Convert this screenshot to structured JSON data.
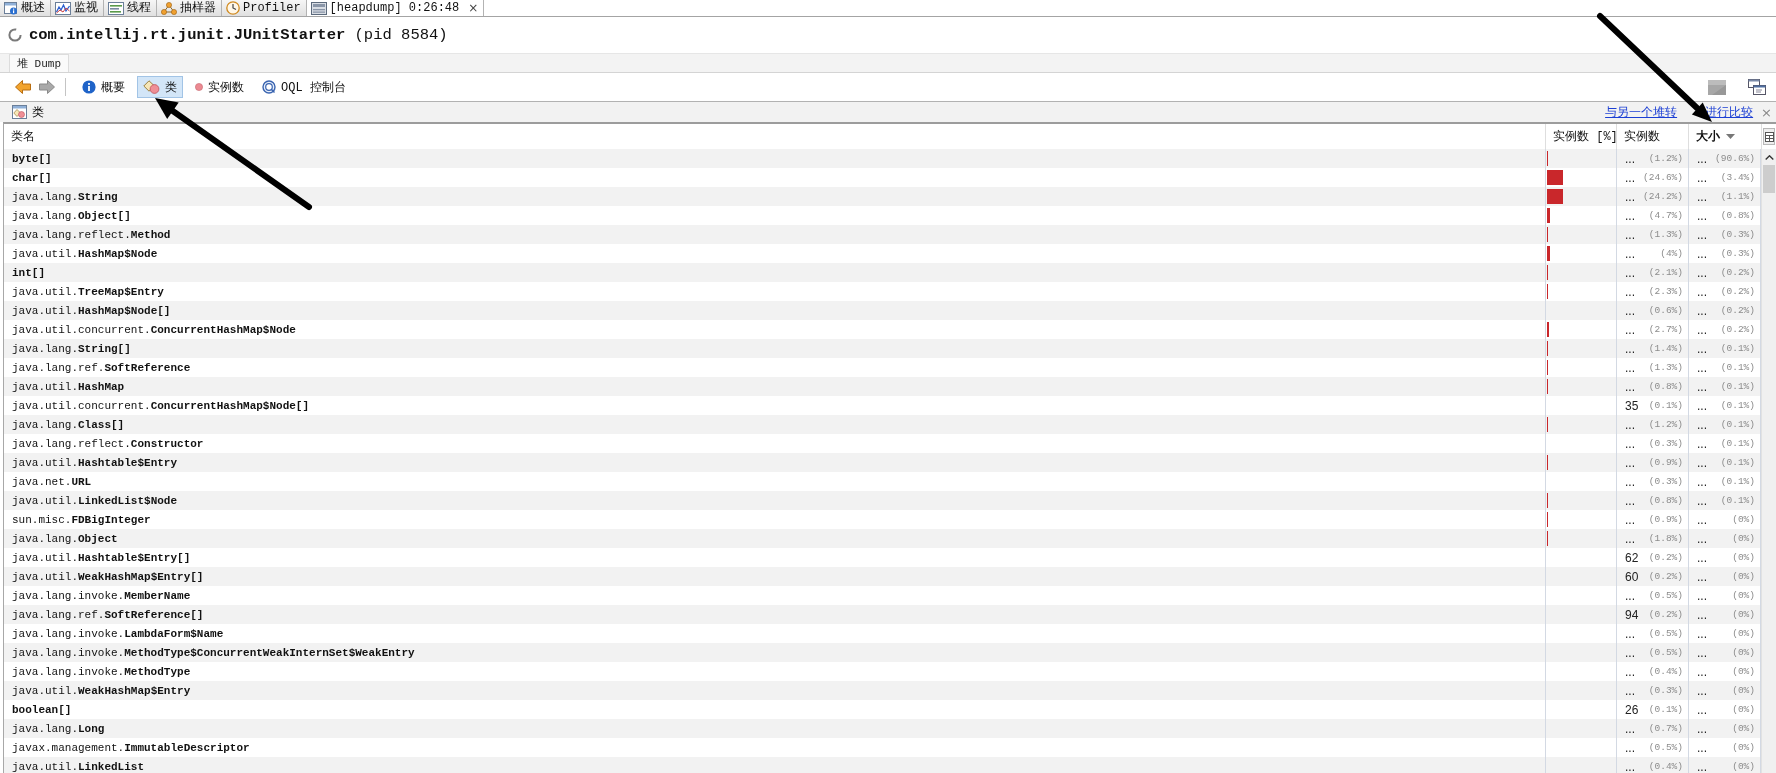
{
  "tabs": [
    {
      "kind": "overview",
      "label": "概述",
      "selected": false
    },
    {
      "kind": "monitor",
      "label": "监视",
      "selected": false
    },
    {
      "kind": "threads",
      "label": "线程",
      "selected": false
    },
    {
      "kind": "sampler",
      "label": "抽样器",
      "selected": false
    },
    {
      "kind": "profiler",
      "label": "Profiler",
      "selected": false
    },
    {
      "kind": "heapdump",
      "label": "[heapdump] 0:26:48",
      "close": "×",
      "selected": true
    }
  ],
  "title": "**com.intellij.rt.junit.JUnitStarter** (pid 8584)",
  "subtabs": [
    {
      "label": "堆 Dump",
      "selected": true
    }
  ],
  "toolbar": {
    "nav": [
      {
        "kind": "back",
        "disabled": false
      },
      {
        "kind": "forward",
        "disabled": true
      }
    ],
    "views": [
      {
        "kind": "summary",
        "label": "概要",
        "selected": false
      },
      {
        "kind": "classes",
        "label": "类",
        "selected": true
      },
      {
        "kind": "instances",
        "label": "实例数",
        "selected": false
      },
      {
        "kind": "oql",
        "label": "OQL 控制台",
        "selected": false
      }
    ],
    "tools": [
      {
        "kind": "square"
      },
      {
        "kind": "window"
      }
    ]
  },
  "panel": {
    "title": "类",
    "compare_link": [
      "与另一个堆转",
      "进行比较"
    ],
    "close": "×"
  },
  "table": {
    "columns": [
      {
        "label": "类名",
        "sorted": false
      },
      {
        "label": "实例数 [%]",
        "sorted": false
      },
      {
        "label": "实例数",
        "sorted": false
      },
      {
        "label": "大小",
        "sorted": true
      }
    ],
    "rows": [
      {
        "class": "byte[]",
        "level": 0.012,
        "instances": "...",
        "instances_pct": "(1.2%)",
        "size": "...",
        "size_pct": "(90.6%)"
      },
      {
        "class": "char[]",
        "level": 0.246,
        "instances": "...",
        "instances_pct": "(24.6%)",
        "size": "...",
        "size_pct": "(3.4%)"
      },
      {
        "package": "java.lang.",
        "class": "String",
        "level": 0.242,
        "instances": "...",
        "instances_pct": "(24.2%)",
        "size": "...",
        "size_pct": "(1.1%)"
      },
      {
        "package": "java.lang.",
        "class": "Object[]",
        "level": 0.047,
        "instances": "...",
        "instances_pct": "(4.7%)",
        "size": "...",
        "size_pct": "(0.8%)"
      },
      {
        "package": "java.lang.reflect.",
        "class": "Method",
        "level": 0.013,
        "instances": "...",
        "instances_pct": "(1.3%)",
        "size": "...",
        "size_pct": "(0.3%)"
      },
      {
        "package": "java.util.",
        "class": "HashMap$Node",
        "level": 0.04,
        "instances": "...",
        "instances_pct": "(4%)",
        "size": "...",
        "size_pct": "(0.3%)"
      },
      {
        "class": "int[]",
        "level": 0.021,
        "instances": "...",
        "instances_pct": "(2.1%)",
        "size": "...",
        "size_pct": "(0.2%)"
      },
      {
        "package": "java.util.",
        "class": "TreeMap$Entry",
        "level": 0.023,
        "instances": "...",
        "instances_pct": "(2.3%)",
        "size": "...",
        "size_pct": "(0.2%)"
      },
      {
        "package": "java.util.",
        "class": "HashMap$Node[]",
        "level": 0.006,
        "instances": "...",
        "instances_pct": "(0.6%)",
        "size": "...",
        "size_pct": "(0.2%)"
      },
      {
        "package": "java.util.concurrent.",
        "class": "ConcurrentHashMap$Node",
        "level": 0.027,
        "instances": "...",
        "instances_pct": "(2.7%)",
        "size": "...",
        "size_pct": "(0.2%)"
      },
      {
        "package": "java.lang.",
        "class": "String[]",
        "level": 0.014,
        "instances": "...",
        "instances_pct": "(1.4%)",
        "size": "...",
        "size_pct": "(0.1%)"
      },
      {
        "package": "java.lang.ref.",
        "class": "SoftReference",
        "level": 0.013,
        "instances": "...",
        "instances_pct": "(1.3%)",
        "size": "...",
        "size_pct": "(0.1%)"
      },
      {
        "package": "java.util.",
        "class": "HashMap",
        "level": 0.008,
        "instances": "...",
        "instances_pct": "(0.8%)",
        "size": "...",
        "size_pct": "(0.1%)"
      },
      {
        "package": "java.util.concurrent.",
        "class": "ConcurrentHashMap$Node[]",
        "level": 0.001,
        "instances": "35",
        "instances_pct": "(0.1%)",
        "size": "...",
        "size_pct": "(0.1%)"
      },
      {
        "package": "java.lang.",
        "class": "Class[]",
        "level": 0.012,
        "instances": "...",
        "instances_pct": "(1.2%)",
        "size": "...",
        "size_pct": "(0.1%)"
      },
      {
        "package": "java.lang.reflect.",
        "class": "Constructor",
        "level": 0.003,
        "instances": "...",
        "instances_pct": "(0.3%)",
        "size": "...",
        "size_pct": "(0.1%)"
      },
      {
        "package": "java.util.",
        "class": "Hashtable$Entry",
        "level": 0.009,
        "instances": "...",
        "instances_pct": "(0.9%)",
        "size": "...",
        "size_pct": "(0.1%)"
      },
      {
        "package": "java.net.",
        "class": "URL",
        "level": 0.003,
        "instances": "...",
        "instances_pct": "(0.3%)",
        "size": "...",
        "size_pct": "(0.1%)"
      },
      {
        "package": "java.util.",
        "class": "LinkedList$Node",
        "level": 0.008,
        "instances": "...",
        "instances_pct": "(0.8%)",
        "size": "...",
        "size_pct": "(0.1%)"
      },
      {
        "package": "sun.misc.",
        "class": "FDBigInteger",
        "level": 0.009,
        "instances": "...",
        "instances_pct": "(0.9%)",
        "size": "...",
        "size_pct": "(0%)"
      },
      {
        "package": "java.lang.",
        "class": "Object",
        "level": 0.018,
        "instances": "...",
        "instances_pct": "(1.8%)",
        "size": "...",
        "size_pct": "(0%)"
      },
      {
        "package": "java.util.",
        "class": "Hashtable$Entry[]",
        "level": 0.002,
        "instances": "62",
        "instances_pct": "(0.2%)",
        "size": "...",
        "size_pct": "(0%)"
      },
      {
        "package": "java.util.",
        "class": "WeakHashMap$Entry[]",
        "level": 0.002,
        "instances": "60",
        "instances_pct": "(0.2%)",
        "size": "...",
        "size_pct": "(0%)"
      },
      {
        "package": "java.lang.invoke.",
        "class": "MemberName",
        "level": 0.005,
        "instances": "...",
        "instances_pct": "(0.5%)",
        "size": "...",
        "size_pct": "(0%)"
      },
      {
        "package": "java.lang.ref.",
        "class": "SoftReference[]",
        "level": 0.002,
        "instances": "94",
        "instances_pct": "(0.2%)",
        "size": "...",
        "size_pct": "(0%)"
      },
      {
        "package": "java.lang.invoke.",
        "class": "LambdaForm$Name",
        "level": 0.005,
        "instances": "...",
        "instances_pct": "(0.5%)",
        "size": "...",
        "size_pct": "(0%)"
      },
      {
        "package": "java.lang.invoke.",
        "class": "MethodType$ConcurrentWeakInternSet$WeakEntry",
        "level": 0.005,
        "instances": "...",
        "instances_pct": "(0.5%)",
        "size": "...",
        "size_pct": "(0%)"
      },
      {
        "package": "java.lang.invoke.",
        "class": "MethodType",
        "level": 0.004,
        "instances": "...",
        "instances_pct": "(0.4%)",
        "size": "...",
        "size_pct": "(0%)"
      },
      {
        "package": "java.util.",
        "class": "WeakHashMap$Entry",
        "level": 0.003,
        "instances": "...",
        "instances_pct": "(0.3%)",
        "size": "...",
        "size_pct": "(0%)"
      },
      {
        "class": "boolean[]",
        "level": 0.001,
        "instances": "26",
        "instances_pct": "(0.1%)",
        "size": "...",
        "size_pct": "(0%)"
      },
      {
        "package": "java.lang.",
        "class": "Long",
        "level": 0.007,
        "instances": "...",
        "instances_pct": "(0.7%)",
        "size": "...",
        "size_pct": "(0%)"
      },
      {
        "package": "javax.management.",
        "class": "ImmutableDescriptor",
        "level": 0.005,
        "instances": "...",
        "instances_pct": "(0.5%)",
        "size": "...",
        "size_pct": "(0%)"
      },
      {
        "package": "java.util.",
        "class": "LinkedList",
        "level": 0.004,
        "instances": "...",
        "instances_pct": "(0.4%)",
        "size": "...",
        "size_pct": "(0%)"
      }
    ]
  }
}
